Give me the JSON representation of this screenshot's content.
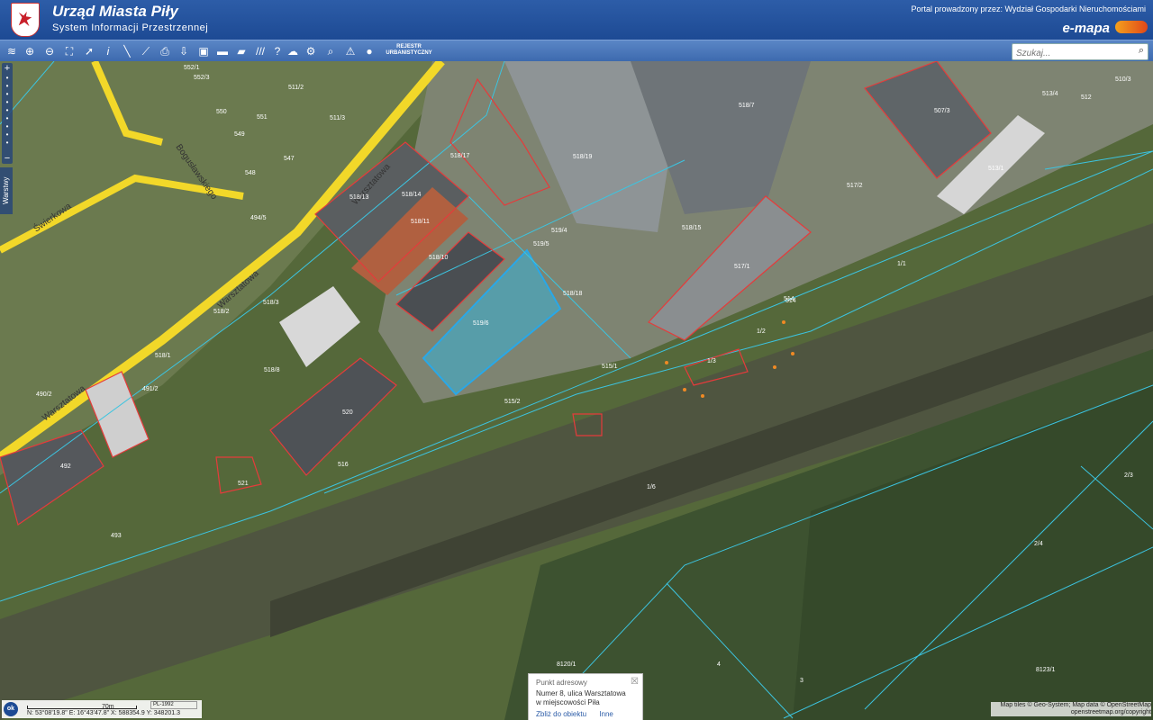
{
  "header": {
    "title": "Urząd Miasta Piły",
    "subtitle": "System Informacji Przestrzennej",
    "portal": "Portal prowadzony przez: Wydział Gospodarki Nieruchomościami",
    "brand": "e-mapa"
  },
  "toolbar": {
    "register_label": "REJESTR URBANISTYCZNY",
    "search_placeholder": "Szukaj...",
    "icons": [
      "layers-icon",
      "zoom-in-icon",
      "zoom-out-icon",
      "zoom-extent-icon",
      "pointer-icon",
      "info-icon",
      "measure-line-icon",
      "measure-area-icon",
      "print-icon",
      "download-icon",
      "export-icon",
      "fill-icon",
      "comment-icon",
      "hatch-icon",
      "help-icon",
      "cloud-icon",
      "settings-icon",
      "find-icon",
      "warning-icon",
      "point-icon"
    ]
  },
  "map": {
    "streets": [
      "Warsztatowa",
      "Warsztatowa",
      "Warsztatowa",
      "Bogusławskiego",
      "Świerkowa"
    ],
    "parcels": [
      "519/6",
      "518/18",
      "519/5",
      "518/10",
      "518/11",
      "518/14",
      "518/13",
      "518/17",
      "518/19",
      "519/4",
      "518/15",
      "517/1",
      "517/2",
      "514",
      "513/1",
      "507/3",
      "518/7",
      "513/4",
      "512",
      "510/3",
      "518/1",
      "518/2",
      "518/3",
      "518/8",
      "520",
      "516",
      "521",
      "492",
      "493",
      "491/2",
      "490/2",
      "494/5",
      "548",
      "550",
      "551",
      "552/1",
      "552/3",
      "547",
      "549",
      "511/2",
      "511/3",
      "515/1",
      "515/2",
      "514",
      "1/1",
      "1/2",
      "1/3",
      "1/6",
      "2/3",
      "2/4",
      "4",
      "3",
      "8120/1",
      "8123/1"
    ],
    "layers_tab": "Warstwy"
  },
  "scale": {
    "ok_label": "ok",
    "distance": "70m",
    "crs": "PL-1992",
    "coordinates": "N: 53°08'19.8\"  E: 16°43'47.8\"  X: 588354.9  Y: 348201.3"
  },
  "popup": {
    "title": "Punkt adresowy",
    "line1": "Numer 8, ulica Warsztatowa",
    "line2": "w miejscowości Piła",
    "link_zoom": "Zbliż do obiektu",
    "link_other": "Inne"
  },
  "attribution": {
    "line1": "Map tiles © Geo-System; Map data © OpenStreetMap",
    "line2": "openstreetmap.org/copyright"
  }
}
